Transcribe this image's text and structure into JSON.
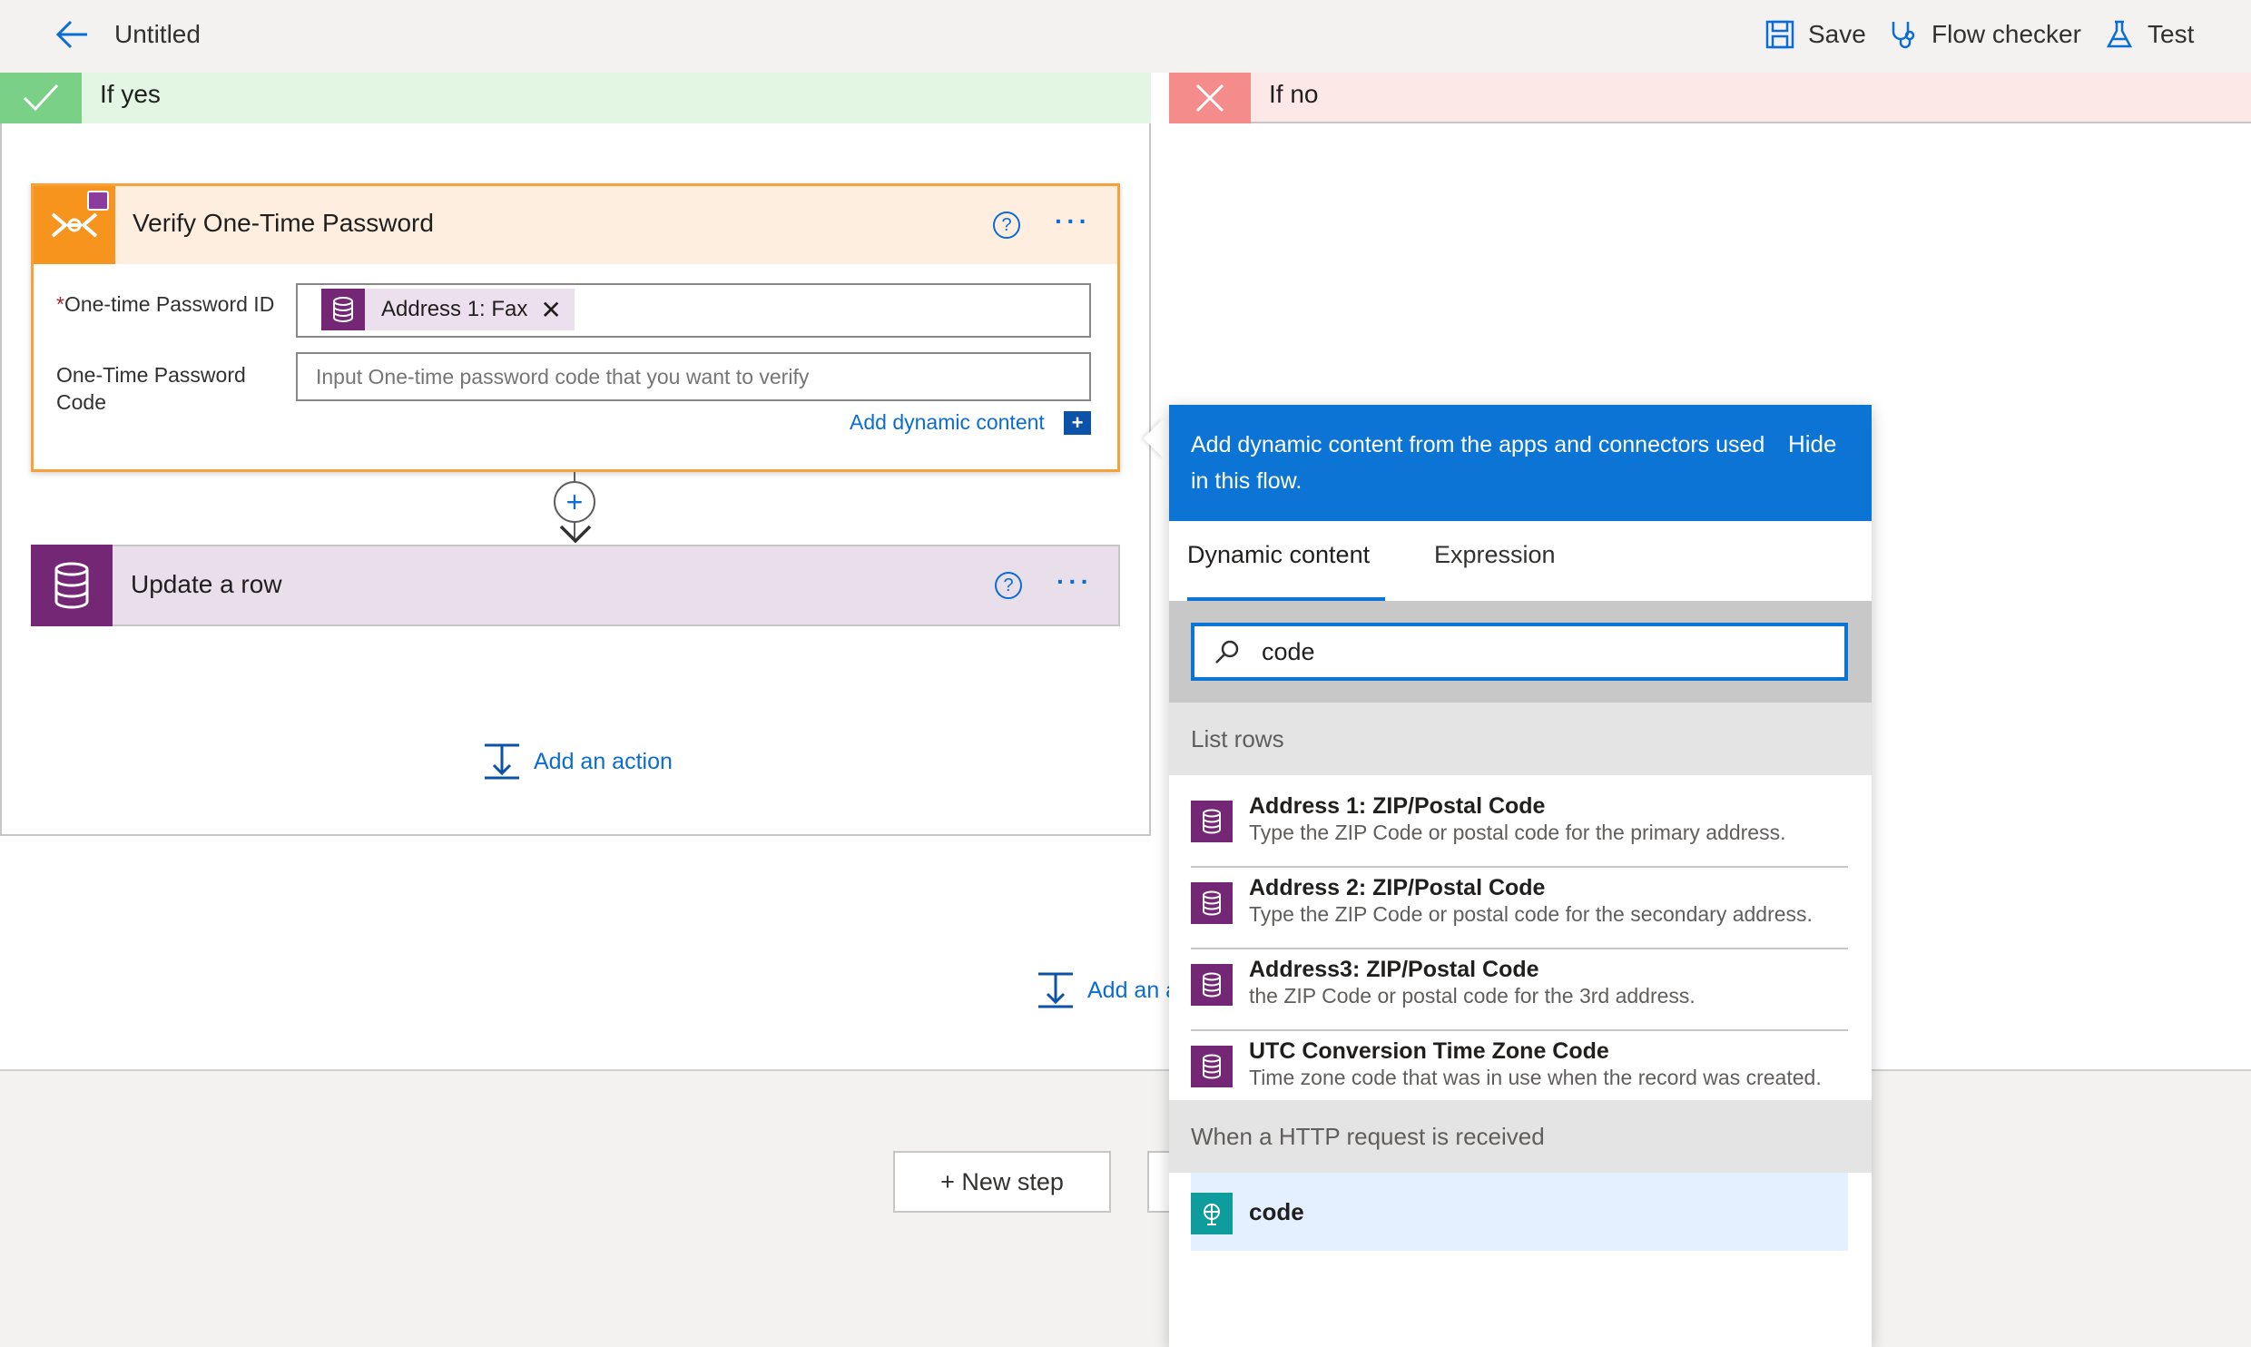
{
  "topbar": {
    "title": "Untitled",
    "save_label": "Save",
    "flow_checker_label": "Flow checker",
    "test_label": "Test"
  },
  "branches": {
    "yes_label": "If yes",
    "no_label": "If no"
  },
  "verify_card": {
    "title": "Verify One-Time Password",
    "field1_label": "One-time Password ID",
    "field1_token": "Address 1: Fax",
    "field2_label": "One-Time Password Code",
    "field2_placeholder": "Input One-time password code that you want to verify",
    "add_dynamic_label": "Add dynamic content"
  },
  "update_card": {
    "title": "Update a row"
  },
  "add_action_label": "Add an action",
  "add_action_partial_label": "Add an a",
  "new_step_label": "+ New step",
  "dynamic_panel": {
    "header_text": "Add dynamic content from the apps and connectors used in this flow.",
    "hide_label": "Hide",
    "tabs": [
      "Dynamic content",
      "Expression"
    ],
    "search_value": "code",
    "sections": [
      {
        "title": "List rows",
        "items": [
          {
            "title": "Address 1: ZIP/Postal Code",
            "desc": "Type the ZIP Code or postal code for the primary address."
          },
          {
            "title": "Address 2: ZIP/Postal Code",
            "desc": "Type the ZIP Code or postal code for the secondary address."
          },
          {
            "title": "Address3: ZIP/Postal Code",
            "desc": "the ZIP Code or postal code for the 3rd address."
          },
          {
            "title": "UTC Conversion Time Zone Code",
            "desc": "Time zone code that was in use when the record was created."
          }
        ]
      },
      {
        "title": "When a HTTP request is received",
        "items": [
          {
            "title": "code"
          }
        ]
      }
    ]
  },
  "colors": {
    "accent": "#0b74d4",
    "dataverse": "#742774",
    "otp": "#f7941d",
    "yes": "#79d086",
    "no": "#f48c8c"
  }
}
